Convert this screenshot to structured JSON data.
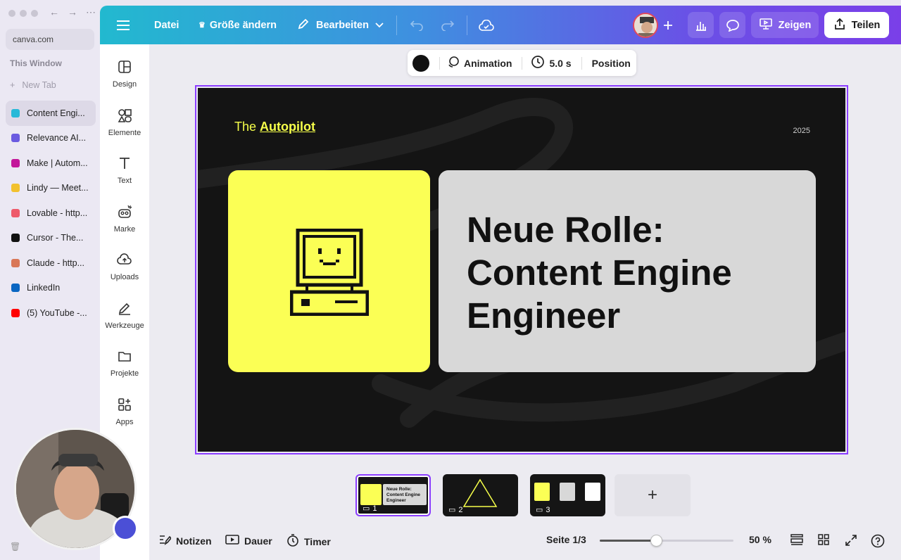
{
  "browser": {
    "url": "canva.com",
    "section_title": "This Window",
    "new_tab": "New Tab",
    "tabs": [
      {
        "label": "Content Engi...",
        "color": "#27b9d8",
        "active": true
      },
      {
        "label": "Relevance AI...",
        "color": "#6a5ae0",
        "active": false
      },
      {
        "label": "Make | Autom...",
        "color": "#c3179a",
        "active": false
      },
      {
        "label": "Lindy — Meet...",
        "color": "#f2c12e",
        "active": false
      },
      {
        "label": "Lovable - http...",
        "color": "#ee5a6a",
        "active": false
      },
      {
        "label": "Cursor - The...",
        "color": "#111111",
        "active": false
      },
      {
        "label": "Claude - http...",
        "color": "#d97757",
        "active": false
      },
      {
        "label": "LinkedIn",
        "color": "#0a66c2",
        "active": false
      },
      {
        "label": "(5) YouTube -...",
        "color": "#ff0000",
        "active": false
      }
    ]
  },
  "topbar": {
    "file": "Datei",
    "resize": "Größe ändern",
    "edit": "Bearbeiten",
    "present": "Zeigen",
    "share": "Teilen"
  },
  "tools": [
    {
      "label": "Design",
      "icon": "design-icon"
    },
    {
      "label": "Elemente",
      "icon": "elements-icon"
    },
    {
      "label": "Text",
      "icon": "text-icon"
    },
    {
      "label": "Marke",
      "icon": "brand-icon"
    },
    {
      "label": "Uploads",
      "icon": "upload-icon"
    },
    {
      "label": "Werkzeuge",
      "icon": "tools-icon"
    },
    {
      "label": "Projekte",
      "icon": "folder-icon"
    },
    {
      "label": "Apps",
      "icon": "apps-icon"
    }
  ],
  "context_toolbar": {
    "animation": "Animation",
    "duration": "5.0 s",
    "position": "Position"
  },
  "slide": {
    "brand_prefix": "The",
    "brand_name": "Autopilot",
    "year": "2025",
    "headline_lines": [
      "Neue Rolle:",
      "Content Engine",
      "Engineer"
    ]
  },
  "pages": [
    {
      "number": "1",
      "active": true
    },
    {
      "number": "2",
      "active": false
    },
    {
      "number": "3",
      "active": false
    }
  ],
  "add_page": "+",
  "bottombar": {
    "notes": "Notizen",
    "duration": "Dauer",
    "timer": "Timer",
    "page_indicator": "Seite 1/3",
    "zoom": "50 %",
    "zoom_fraction": 0.42
  }
}
